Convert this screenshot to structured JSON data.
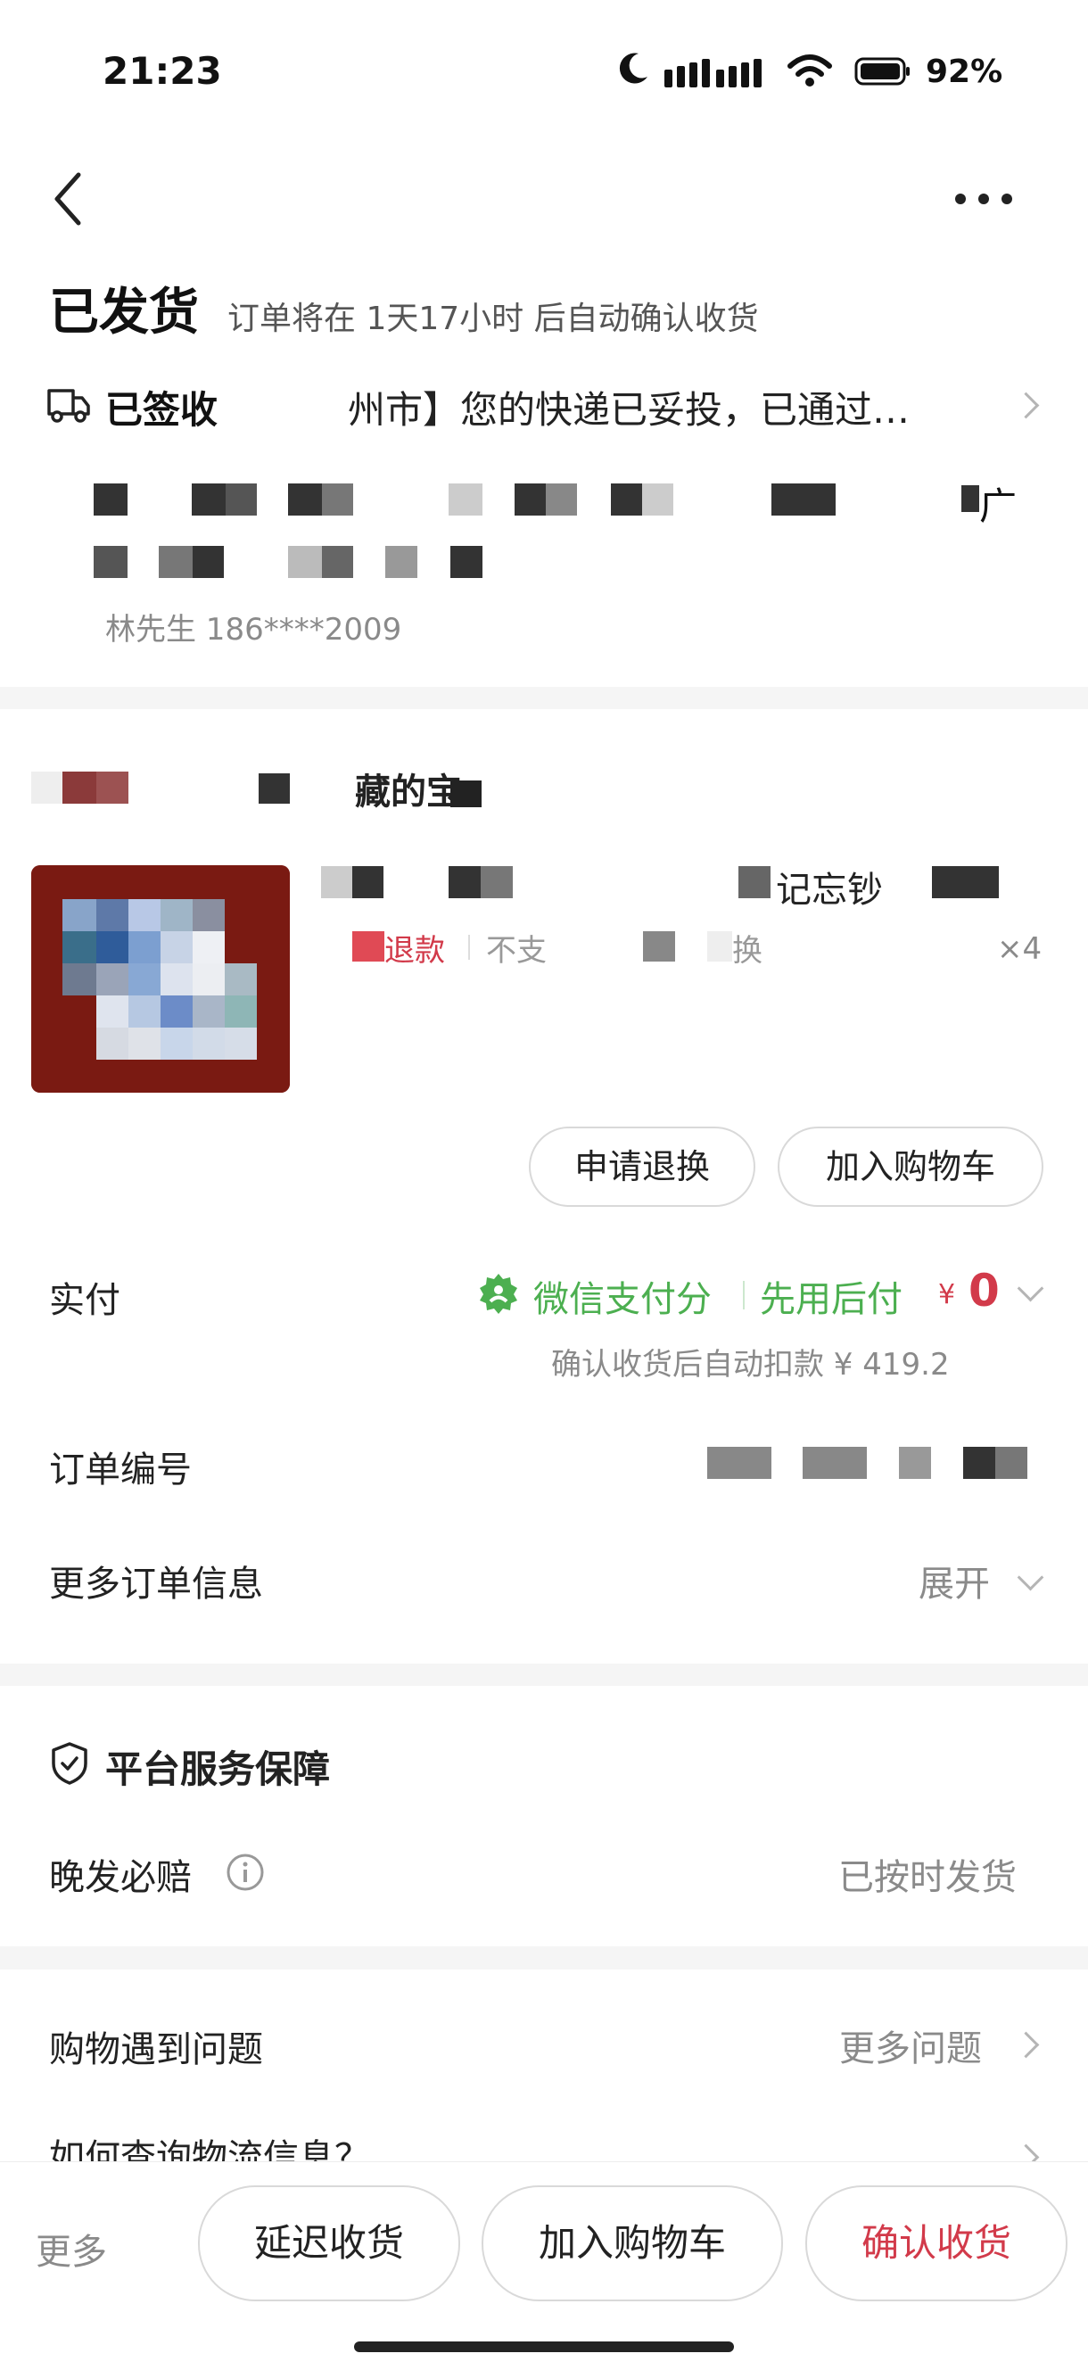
{
  "status_bar": {
    "time": "21:23",
    "battery": "92%"
  },
  "order": {
    "status": "已发货",
    "auto_confirm": "订单将在 1天17小时 后自动确认收货",
    "delivery_label": "已签收",
    "delivery_text": "州市】您的快递已妥投，已通过…",
    "address_tail": "广",
    "recipient": "林先生 186****2009"
  },
  "shop": {
    "name_partial": "藏的宝"
  },
  "product": {
    "title_partial": "记忘钞",
    "tag_refund": "退款",
    "tag_partial": "不支",
    "tag_exchange": "换",
    "quantity": "×4",
    "btn_return": "申请退换",
    "btn_add_cart": "加入购物车"
  },
  "payment": {
    "label": "实付",
    "wechat_score": "微信支付分",
    "pay_later": "先用后付",
    "currency": "¥",
    "amount": "0",
    "note": "确认收货后自动扣款 ¥ 419.2"
  },
  "order_info": {
    "number_label": "订单编号",
    "more_label": "更多订单信息",
    "expand": "展开"
  },
  "guarantee": {
    "title": "平台服务保障",
    "late_label": "晚发必赔",
    "late_status": "已按时发货"
  },
  "help": {
    "title": "购物遇到问题",
    "more": "更多问题",
    "question1": "如何查询物流信息？"
  },
  "bottom_bar": {
    "more": "更多",
    "delay": "延迟收货",
    "add_cart": "加入购物车",
    "confirm": "确认收货"
  },
  "colors": {
    "accent_red": "#d23a4a",
    "wechat_green": "#4caf50"
  }
}
